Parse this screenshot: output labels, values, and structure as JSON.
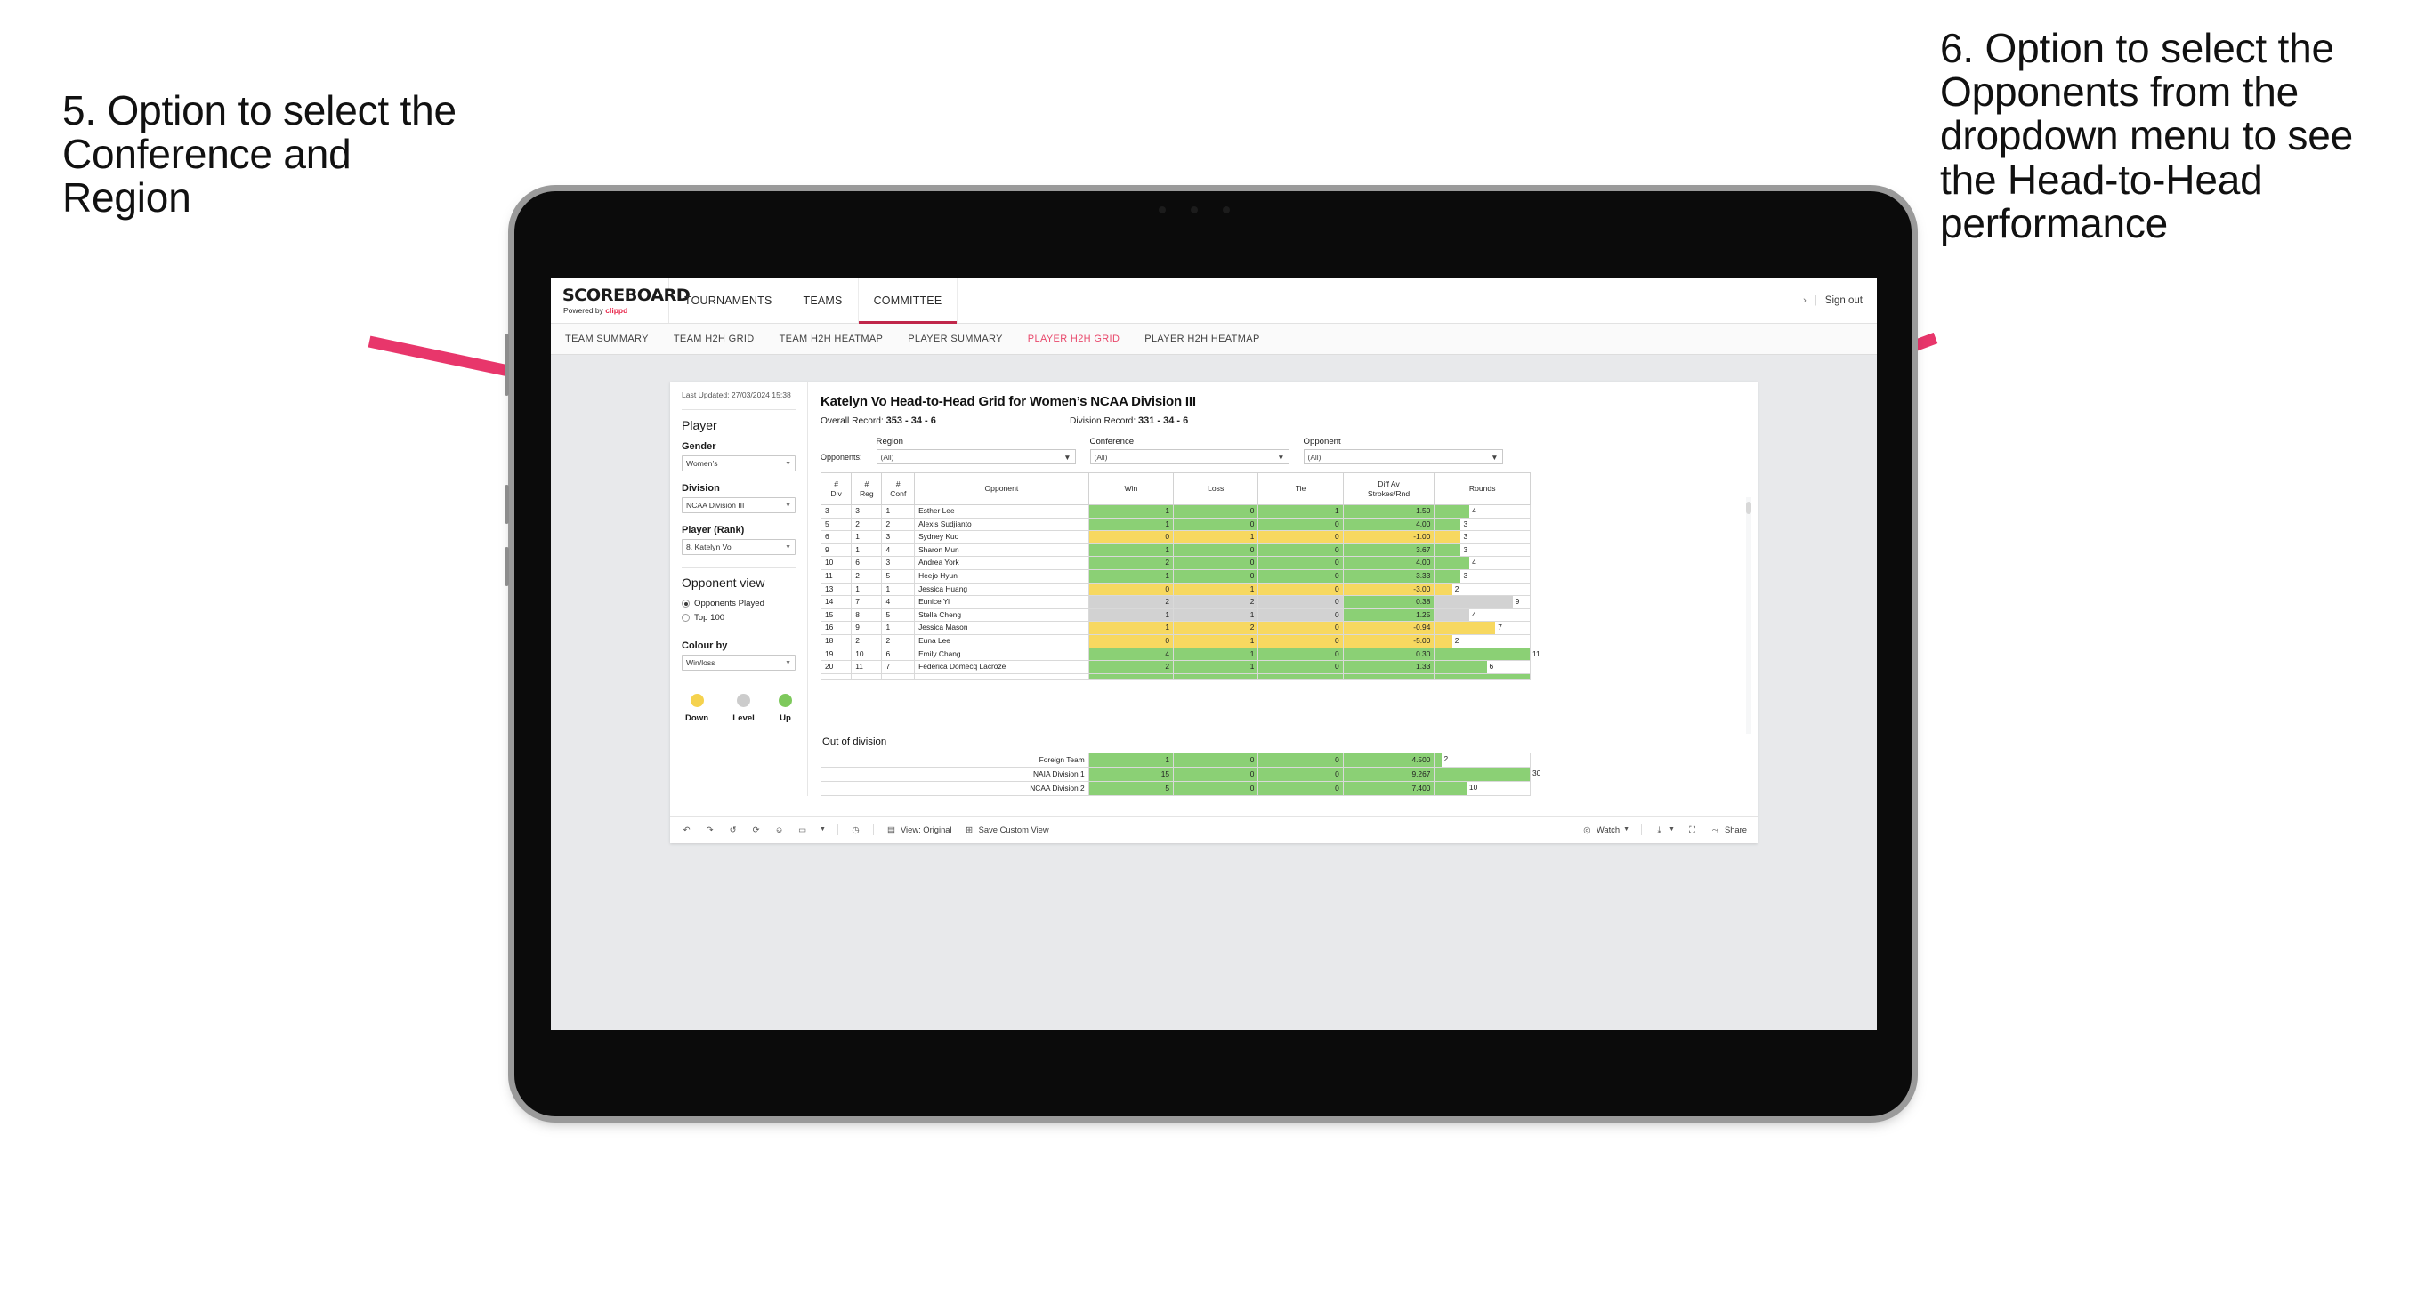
{
  "annotations": {
    "left": "5. Option to select the Conference and Region",
    "right": "6. Option to select the Opponents from the dropdown menu to see the Head-to-Head performance",
    "arrow_color": "#e8366b"
  },
  "app": {
    "logo_word": "SCOREBOARD",
    "logo_powered": "Powered by ",
    "logo_brand": "clippd",
    "nav": [
      {
        "label": "TOURNAMENTS",
        "active": false
      },
      {
        "label": "TEAMS",
        "active": false
      },
      {
        "label": "COMMITTEE",
        "active": true
      }
    ],
    "chevron": "›",
    "separator": "|",
    "sign_out": "Sign out",
    "subtabs": [
      {
        "label": "TEAM SUMMARY",
        "active": false
      },
      {
        "label": "TEAM H2H GRID",
        "active": false
      },
      {
        "label": "TEAM H2H HEATMAP",
        "active": false
      },
      {
        "label": "PLAYER SUMMARY",
        "active": false
      },
      {
        "label": "PLAYER H2H GRID",
        "active": true
      },
      {
        "label": "PLAYER H2H HEATMAP",
        "active": false
      }
    ],
    "accent": "#e8486b"
  },
  "sidebar": {
    "last_updated": "Last Updated: 27/03/2024 15:38",
    "player_heading": "Player",
    "gender": {
      "label": "Gender",
      "value": "Women’s"
    },
    "division": {
      "label": "Division",
      "value": "NCAA Division III"
    },
    "player_rank": {
      "label": "Player (Rank)",
      "value": "8. Katelyn Vo"
    },
    "opponent_view": {
      "heading": "Opponent view",
      "options": [
        {
          "label": "Opponents Played",
          "selected": true
        },
        {
          "label": "Top 100",
          "selected": false
        }
      ]
    },
    "colour_by": {
      "label": "Colour by",
      "value": "Win/loss"
    },
    "legend": [
      {
        "label": "Down",
        "color": "#f5d24e"
      },
      {
        "label": "Level",
        "color": "#cccccc"
      },
      {
        "label": "Up",
        "color": "#7ec95c"
      }
    ]
  },
  "main": {
    "title": "Katelyn Vo Head-to-Head Grid for Women’s NCAA Division III",
    "overall_record_label": "Overall Record: ",
    "overall_record_value": "353 - 34 - 6",
    "division_record_label": "Division Record: ",
    "division_record_value": "331 - 34 - 6",
    "opponents_label": "Opponents:",
    "filters": [
      {
        "label": "Region",
        "value": "(All)"
      },
      {
        "label": "Conference",
        "value": "(All)"
      },
      {
        "label": "Opponent",
        "value": "(All)"
      }
    ]
  },
  "chart_data": {
    "type": "table",
    "title": "Katelyn Vo Head-to-Head Grid for Women’s NCAA Division III",
    "columns": [
      "# Div",
      "# Reg",
      "# Conf",
      "Opponent",
      "Win",
      "Loss",
      "Tie",
      "Diff Av Strokes/Rnd",
      "Rounds"
    ],
    "column_headers_multiline": [
      {
        "top": "#",
        "bottom": "Div"
      },
      {
        "top": "#",
        "bottom": "Reg"
      },
      {
        "top": "#",
        "bottom": "Conf"
      },
      {
        "top": "",
        "bottom": "Opponent"
      },
      {
        "top": "",
        "bottom": "Win"
      },
      {
        "top": "",
        "bottom": "Loss"
      },
      {
        "top": "",
        "bottom": "Tie"
      },
      {
        "top": "Diff Av",
        "bottom": "Strokes/Rnd"
      },
      {
        "top": "",
        "bottom": "Rounds"
      }
    ],
    "rows": [
      {
        "div": "3",
        "reg": "3",
        "conf": "1",
        "opponent": "Esther Lee",
        "win": "1",
        "loss": "0",
        "tie": "1",
        "diff": "1.50",
        "rounds": 4,
        "state": "up"
      },
      {
        "div": "5",
        "reg": "2",
        "conf": "2",
        "opponent": "Alexis Sudjianto",
        "win": "1",
        "loss": "0",
        "tie": "0",
        "diff": "4.00",
        "rounds": 3,
        "state": "up"
      },
      {
        "div": "6",
        "reg": "1",
        "conf": "3",
        "opponent": "Sydney Kuo",
        "win": "0",
        "loss": "1",
        "tie": "0",
        "diff": "-1.00",
        "rounds": 3,
        "state": "down"
      },
      {
        "div": "9",
        "reg": "1",
        "conf": "4",
        "opponent": "Sharon Mun",
        "win": "1",
        "loss": "0",
        "tie": "0",
        "diff": "3.67",
        "rounds": 3,
        "state": "up"
      },
      {
        "div": "10",
        "reg": "6",
        "conf": "3",
        "opponent": "Andrea York",
        "win": "2",
        "loss": "0",
        "tie": "0",
        "diff": "4.00",
        "rounds": 4,
        "state": "up"
      },
      {
        "div": "11",
        "reg": "2",
        "conf": "5",
        "opponent": "Heejo Hyun",
        "win": "1",
        "loss": "0",
        "tie": "0",
        "diff": "3.33",
        "rounds": 3,
        "state": "up"
      },
      {
        "div": "13",
        "reg": "1",
        "conf": "1",
        "opponent": "Jessica Huang",
        "win": "0",
        "loss": "1",
        "tie": "0",
        "diff": "-3.00",
        "rounds": 2,
        "state": "down"
      },
      {
        "div": "14",
        "reg": "7",
        "conf": "4",
        "opponent": "Eunice Yi",
        "win": "2",
        "loss": "2",
        "tie": "0",
        "diff": "0.38",
        "rounds": 9,
        "state": "level",
        "diff_state": "up"
      },
      {
        "div": "15",
        "reg": "8",
        "conf": "5",
        "opponent": "Stella Cheng",
        "win": "1",
        "loss": "1",
        "tie": "0",
        "diff": "1.25",
        "rounds": 4,
        "state": "level",
        "diff_state": "up"
      },
      {
        "div": "16",
        "reg": "9",
        "conf": "1",
        "opponent": "Jessica Mason",
        "win": "1",
        "loss": "2",
        "tie": "0",
        "diff": "-0.94",
        "rounds": 7,
        "state": "down"
      },
      {
        "div": "18",
        "reg": "2",
        "conf": "2",
        "opponent": "Euna Lee",
        "win": "0",
        "loss": "1",
        "tie": "0",
        "diff": "-5.00",
        "rounds": 2,
        "state": "down"
      },
      {
        "div": "19",
        "reg": "10",
        "conf": "6",
        "opponent": "Emily Chang",
        "win": "4",
        "loss": "1",
        "tie": "0",
        "diff": "0.30",
        "rounds": 11,
        "state": "up"
      },
      {
        "div": "20",
        "reg": "11",
        "conf": "7",
        "opponent": "Federica Domecq Lacroze",
        "win": "2",
        "loss": "1",
        "tie": "0",
        "diff": "1.33",
        "rounds": 6,
        "state": "up"
      }
    ],
    "rounds_max": 11,
    "out_of_division": {
      "title": "Out of division",
      "rows": [
        {
          "name": "Foreign Team",
          "win": "1",
          "loss": "0",
          "tie": "0",
          "diff": "4.500",
          "rounds": 2,
          "state": "up"
        },
        {
          "name": "NAIA Division 1",
          "win": "15",
          "loss": "0",
          "tie": "0",
          "diff": "9.267",
          "rounds": 30,
          "state": "up"
        },
        {
          "name": "NCAA Division 2",
          "win": "5",
          "loss": "0",
          "tie": "0",
          "diff": "7.400",
          "rounds": 10,
          "state": "up"
        }
      ],
      "rounds_max": 30
    },
    "colors": {
      "up": "#8bd075",
      "down": "#f7d860",
      "level": "#d2d2d2"
    }
  },
  "toolbar": {
    "view_label": "View: Original",
    "save_label": "Save Custom View",
    "watch_label": "Watch",
    "share_label": "Share"
  }
}
